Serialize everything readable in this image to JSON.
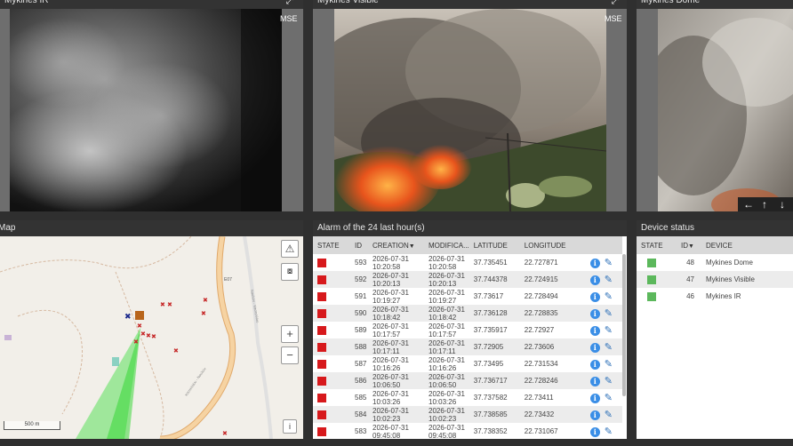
{
  "cameras": [
    {
      "title": "Mykines IR",
      "badge": "MSE"
    },
    {
      "title": "Mykines Visible",
      "badge": "MSE"
    },
    {
      "title": "Mykines Dome"
    }
  ],
  "ptz": {
    "left": "←",
    "up": "↑",
    "down": "↓"
  },
  "map": {
    "title": "Map",
    "scale_label": "500 m",
    "road_labels": [
      "E07",
      "Ναυλών - Καστελλίου",
      "Καστελλίου - Ναυλών"
    ],
    "buttons": {
      "zoom_in": "+",
      "zoom_out": "−",
      "info": "i"
    }
  },
  "alarms": {
    "title": "Alarm of the 24 last hour(s)",
    "columns": [
      "STATE",
      "ID",
      "CREATION",
      "MODIFICA...",
      "LATITUDE",
      "LONGITUDE"
    ],
    "sort_indicator": "▼",
    "rows": [
      {
        "id": "593",
        "created_date": "2026-07-31",
        "created_time": "10:20:58",
        "modified_date": "2026-07-31",
        "modified_time": "10:20:58",
        "lat": "37.735451",
        "lon": "22.727871"
      },
      {
        "id": "592",
        "created_date": "2026-07-31",
        "created_time": "10:20:13",
        "modified_date": "2026-07-31",
        "modified_time": "10:20:13",
        "lat": "37.744378",
        "lon": "22.724915"
      },
      {
        "id": "591",
        "created_date": "2026-07-31",
        "created_time": "10:19:27",
        "modified_date": "2026-07-31",
        "modified_time": "10:19:27",
        "lat": "37.73617",
        "lon": "22.728494"
      },
      {
        "id": "590",
        "created_date": "2026-07-31",
        "created_time": "10:18:42",
        "modified_date": "2026-07-31",
        "modified_time": "10:18:42",
        "lat": "37.736128",
        "lon": "22.728835"
      },
      {
        "id": "589",
        "created_date": "2026-07-31",
        "created_time": "10:17:57",
        "modified_date": "2026-07-31",
        "modified_time": "10:17:57",
        "lat": "37.735917",
        "lon": "22.72927"
      },
      {
        "id": "588",
        "created_date": "2026-07-31",
        "created_time": "10:17:11",
        "modified_date": "2026-07-31",
        "modified_time": "10:17:11",
        "lat": "37.72905",
        "lon": "22.73606"
      },
      {
        "id": "587",
        "created_date": "2026-07-31",
        "created_time": "10:16:26",
        "modified_date": "2026-07-31",
        "modified_time": "10:16:26",
        "lat": "37.73495",
        "lon": "22.731534"
      },
      {
        "id": "586",
        "created_date": "2026-07-31",
        "created_time": "10:06:50",
        "modified_date": "2026-07-31",
        "modified_time": "10:06:50",
        "lat": "37.736717",
        "lon": "22.728246"
      },
      {
        "id": "585",
        "created_date": "2026-07-31",
        "created_time": "10:03:26",
        "modified_date": "2026-07-31",
        "modified_time": "10:03:26",
        "lat": "37.737582",
        "lon": "22.73411"
      },
      {
        "id": "584",
        "created_date": "2026-07-31",
        "created_time": "10:02:23",
        "modified_date": "2026-07-31",
        "modified_time": "10:02:23",
        "lat": "37.738585",
        "lon": "22.73432"
      },
      {
        "id": "583",
        "created_date": "2026-07-31",
        "created_time": "09:45:08",
        "modified_date": "2026-07-31",
        "modified_time": "09:45:08",
        "lat": "37.738352",
        "lon": "22.731067"
      }
    ]
  },
  "devices": {
    "title": "Device status",
    "columns": [
      "STATE",
      "ID",
      "DEVICE"
    ],
    "sort_indicator": "▼",
    "rows": [
      {
        "id": "48",
        "name": "Mykines Dome"
      },
      {
        "id": "47",
        "name": "Mykines Visible"
      },
      {
        "id": "46",
        "name": "Mykines IR"
      }
    ]
  },
  "colors": {
    "alarm_red": "#d7191c",
    "device_ok": "#5cb85c",
    "header_bg": "#333333"
  }
}
